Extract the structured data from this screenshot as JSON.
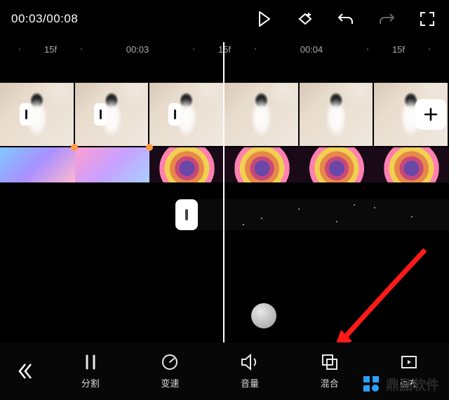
{
  "header": {
    "time_label": "00:03/00:08"
  },
  "ruler": {
    "marks": [
      "15f",
      "00:03",
      "15f",
      "00:04",
      "15f"
    ]
  },
  "toolbar": {
    "items": [
      {
        "key": "split",
        "label": "分割"
      },
      {
        "key": "speed",
        "label": "变速"
      },
      {
        "key": "volume",
        "label": "音量"
      },
      {
        "key": "blend",
        "label": "混合"
      },
      {
        "key": "canvas",
        "label": "画布"
      }
    ]
  },
  "watermark": {
    "text": "鼎品软件"
  }
}
